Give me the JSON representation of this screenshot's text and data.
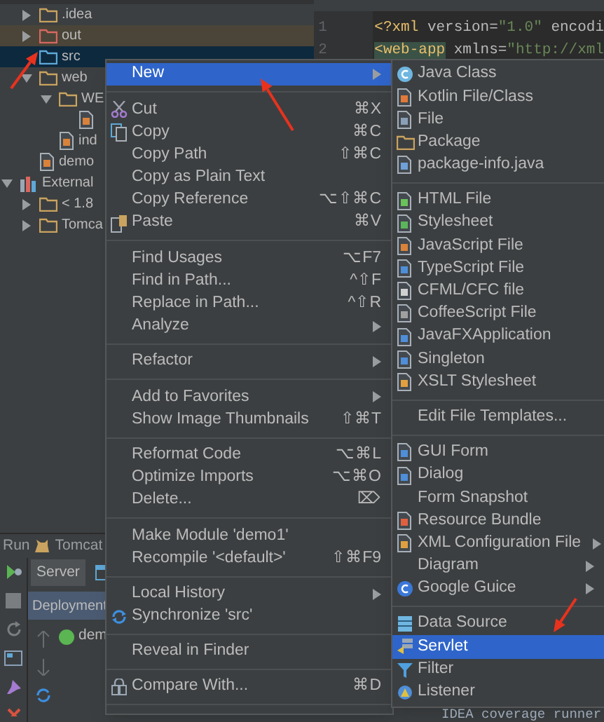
{
  "project_tree": [
    {
      "kind": "module",
      "children": [
        {
          "kind": "folder",
          "label": ".idea",
          "expanded": false,
          "color": "#c9a35f"
        },
        {
          "kind": "folder",
          "label": "out",
          "expanded": false,
          "excluded": true,
          "color": "#d9675f"
        },
        {
          "kind": "folder",
          "label": "src",
          "selected": true,
          "color": "#5fa8d8"
        },
        {
          "kind": "folder",
          "label": "web",
          "expanded": true,
          "color": "#c9a35f",
          "children": [
            {
              "kind": "folder",
              "label": "WE",
              "expanded": true,
              "color": "#c9a35f",
              "children": [
                {
                  "kind": "file"
                }
              ]
            },
            {
              "kind": "file",
              "label": "ind"
            }
          ]
        },
        {
          "kind": "file",
          "label": "demo"
        }
      ]
    },
    {
      "kind": "library",
      "label": "External",
      "expanded": true,
      "children": [
        {
          "kind": "folder",
          "label": "< 1.8",
          "expanded": false,
          "color": "#c9a35f"
        },
        {
          "kind": "folder",
          "label": "Tomca",
          "expanded": false,
          "color": "#c9a35f"
        }
      ]
    }
  ],
  "editor": {
    "lines": [
      {
        "number": "1",
        "segments": [
          {
            "kind": "tag",
            "text": "<?xml"
          },
          {
            "kind": "attr",
            "text": " version="
          },
          {
            "kind": "value",
            "text": "\"1.0\""
          },
          {
            "kind": "attr",
            "text": " encodi"
          }
        ]
      },
      {
        "number": "2",
        "segments": [
          {
            "kind": "tag-match",
            "text": "<web-app"
          },
          {
            "kind": "attr",
            "text": " xmlns="
          },
          {
            "kind": "value",
            "text": "\"http://xml"
          }
        ]
      }
    ]
  },
  "run_panel": {
    "title": "Run",
    "config": "Tomcat",
    "tabs": [
      {
        "label": "Server",
        "selected": true
      },
      {
        "selected": false
      }
    ],
    "deployment_header": "Deployment",
    "deployments": [
      {
        "label": "dem"
      }
    ],
    "console_line": "IDEA coverage runner"
  },
  "context_menu": {
    "items": [
      {
        "kind": "item",
        "label": "New",
        "submenu": true,
        "selected": true
      },
      {
        "kind": "separator"
      },
      {
        "kind": "item",
        "label": "Cut",
        "shortcut": "⌘X",
        "selected": false
      },
      {
        "kind": "item",
        "label": "Copy",
        "shortcut": "⌘C",
        "selected": false
      },
      {
        "kind": "item",
        "label": "Copy Path",
        "shortcut": "⇧⌘C",
        "selected": false
      },
      {
        "kind": "item",
        "label": "Copy as Plain Text",
        "selected": false
      },
      {
        "kind": "item",
        "label": "Copy Reference",
        "shortcut": "⌥⇧⌘C",
        "selected": false
      },
      {
        "kind": "item",
        "label": "Paste",
        "shortcut": "⌘V",
        "selected": false
      },
      {
        "kind": "separator"
      },
      {
        "kind": "item",
        "label": "Find Usages",
        "shortcut": "⌥F7",
        "selected": false
      },
      {
        "kind": "item",
        "label": "Find in Path...",
        "shortcut": "^⇧F",
        "selected": false
      },
      {
        "kind": "item",
        "label": "Replace in Path...",
        "shortcut": "^⇧R",
        "selected": false
      },
      {
        "kind": "item",
        "label": "Analyze",
        "submenu": true,
        "selected": false
      },
      {
        "kind": "separator"
      },
      {
        "kind": "item",
        "label": "Refactor",
        "submenu": true,
        "selected": false
      },
      {
        "kind": "separator"
      },
      {
        "kind": "item",
        "label": "Add to Favorites",
        "submenu": true,
        "selected": false
      },
      {
        "kind": "item",
        "label": "Show Image Thumbnails",
        "shortcut": "⇧⌘T",
        "selected": false
      },
      {
        "kind": "separator"
      },
      {
        "kind": "item",
        "label": "Reformat Code",
        "shortcut": "⌥⌘L",
        "selected": false
      },
      {
        "kind": "item",
        "label": "Optimize Imports",
        "shortcut": "⌥⌘O",
        "selected": false
      },
      {
        "kind": "item",
        "label": "Delete...",
        "shortcut": "⌦",
        "selected": false
      },
      {
        "kind": "separator"
      },
      {
        "kind": "item",
        "label": "Make Module 'demo1'",
        "selected": false
      },
      {
        "kind": "item",
        "label": "Recompile '<default>'",
        "shortcut": "⇧⌘F9",
        "selected": false
      },
      {
        "kind": "separator"
      },
      {
        "kind": "item",
        "label": "Local History",
        "submenu": true,
        "selected": false
      },
      {
        "kind": "item",
        "label": "Synchronize 'src'",
        "selected": false
      },
      {
        "kind": "separator"
      },
      {
        "kind": "item",
        "label": "Reveal in Finder",
        "selected": false
      },
      {
        "kind": "separator"
      },
      {
        "kind": "item",
        "label": "Compare With...",
        "shortcut": "⌘D",
        "selected": false
      },
      {
        "kind": "separator"
      }
    ]
  },
  "new_submenu": {
    "items": [
      {
        "kind": "item",
        "label": "Java Class",
        "selected": false
      },
      {
        "kind": "item",
        "label": "Kotlin File/Class",
        "selected": false
      },
      {
        "kind": "item",
        "label": "File",
        "selected": false
      },
      {
        "kind": "item",
        "label": "Package",
        "selected": false
      },
      {
        "kind": "item",
        "label": "package-info.java",
        "selected": false
      },
      {
        "kind": "separator"
      },
      {
        "kind": "item",
        "label": "HTML File",
        "selected": false
      },
      {
        "kind": "item",
        "label": "Stylesheet",
        "selected": false
      },
      {
        "kind": "item",
        "label": "JavaScript File",
        "selected": false
      },
      {
        "kind": "item",
        "label": "TypeScript File",
        "selected": false
      },
      {
        "kind": "item",
        "label": "CFML/CFC file",
        "selected": false
      },
      {
        "kind": "item",
        "label": "CoffeeScript File",
        "selected": false
      },
      {
        "kind": "item",
        "label": "JavaFXApplication",
        "selected": false
      },
      {
        "kind": "item",
        "label": "Singleton",
        "selected": false
      },
      {
        "kind": "item",
        "label": "XSLT Stylesheet",
        "selected": false
      },
      {
        "kind": "separator"
      },
      {
        "kind": "item",
        "label": "Edit File Templates...",
        "selected": false
      },
      {
        "kind": "separator"
      },
      {
        "kind": "item",
        "label": "GUI Form",
        "selected": false
      },
      {
        "kind": "item",
        "label": "Dialog",
        "selected": false
      },
      {
        "kind": "item",
        "label": "Form Snapshot",
        "selected": false
      },
      {
        "kind": "item",
        "label": "Resource Bundle",
        "selected": false
      },
      {
        "kind": "item",
        "label": "XML Configuration File",
        "submenu": true,
        "selected": false
      },
      {
        "kind": "item",
        "label": "Diagram",
        "submenu": true,
        "selected": false
      },
      {
        "kind": "item",
        "label": "Google Guice",
        "submenu": true,
        "selected": false
      },
      {
        "kind": "separator"
      },
      {
        "kind": "item",
        "label": "Data Source",
        "selected": false
      },
      {
        "kind": "item",
        "label": "Servlet",
        "selected": true
      },
      {
        "kind": "item",
        "label": "Filter",
        "selected": false
      },
      {
        "kind": "item",
        "label": "Listener",
        "selected": false
      }
    ]
  }
}
